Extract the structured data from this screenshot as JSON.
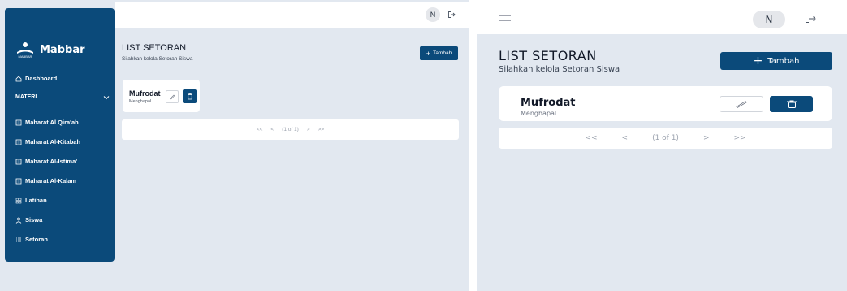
{
  "app": {
    "name": "Mabbar",
    "logo_caption": "MABBAR"
  },
  "header": {
    "avatar_initial": "N"
  },
  "sidebar": {
    "dashboard": "Dashboard",
    "section": "MATERI",
    "items": [
      {
        "label": "Maharat Al Qira'ah",
        "icon": "book-icon"
      },
      {
        "label": "Maharat Al-Kitabah",
        "icon": "book-icon"
      },
      {
        "label": "Maharat Al-Istima'",
        "icon": "book-icon"
      },
      {
        "label": "Maharat Al-Kalam",
        "icon": "book-icon"
      },
      {
        "label": "Latihan",
        "icon": "grid-icon"
      },
      {
        "label": "Siswa",
        "icon": "user-icon"
      },
      {
        "label": "Setoran",
        "icon": "list-icon"
      }
    ]
  },
  "page": {
    "title": "LIST SETORAN",
    "subtitle": "Silahkan kelola Setoran Siswa",
    "add_label": "Tambah"
  },
  "items": [
    {
      "title": "Mufrodat",
      "subtitle": "Menghapal"
    }
  ],
  "pagination": {
    "first": "<<",
    "prev": "<",
    "info": "(1 of 1)",
    "next": ">",
    "last": ">>"
  },
  "colors": {
    "primary": "#0b4a7a",
    "background": "#e2e8f0"
  }
}
